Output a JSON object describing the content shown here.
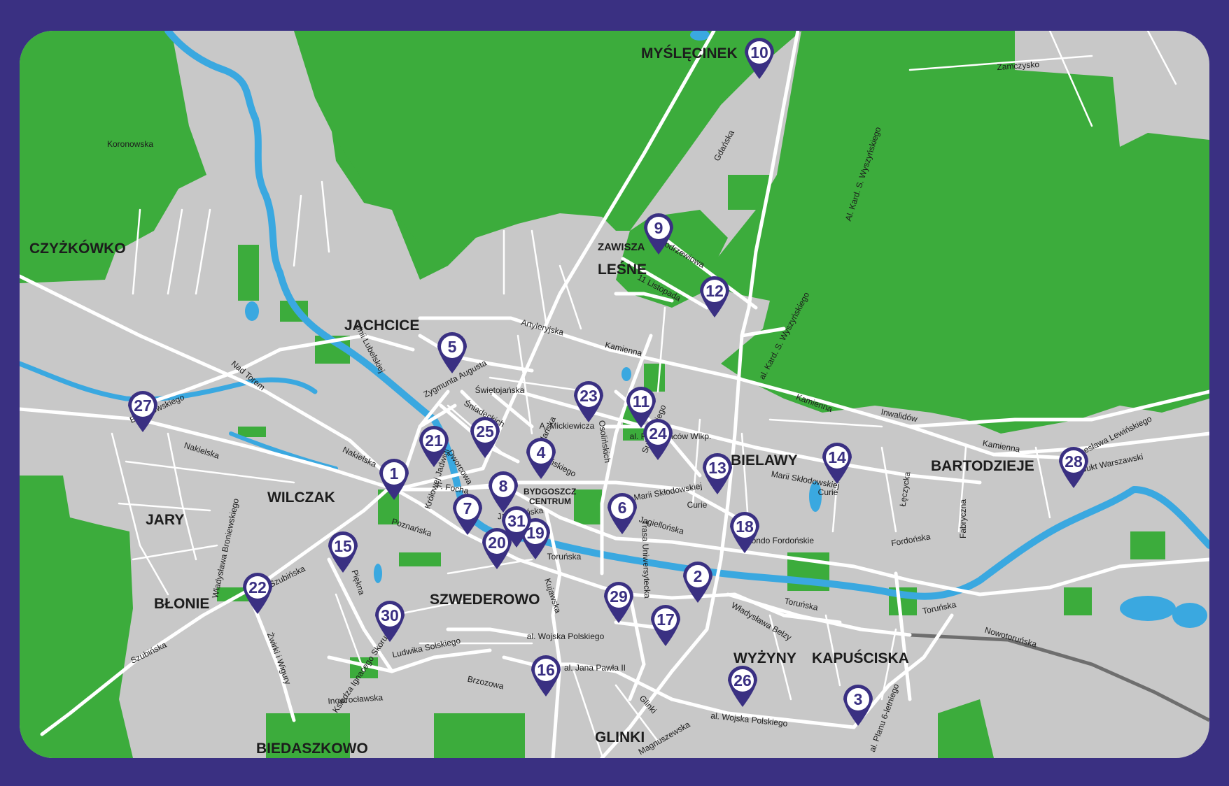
{
  "map": {
    "colors": {
      "frame": "#3a3082",
      "urban": "#c8c8c8",
      "forest": "#3cac3c",
      "water": "#3aa8e0",
      "road": "#ffffff",
      "railway": "#6e6e6e",
      "marker": "#3a3082"
    },
    "districts": [
      {
        "id": "czyzkowko",
        "label": "CZYŻKÓWKO"
      },
      {
        "id": "jachcice",
        "label": "JACHCICE"
      },
      {
        "id": "myslecinek",
        "label": "MYŚLĘCINEK"
      },
      {
        "id": "zawisza",
        "label": "ZAWISZA"
      },
      {
        "id": "lesne",
        "label": "LEŚNE"
      },
      {
        "id": "bielawy",
        "label": "BIELAWY"
      },
      {
        "id": "bartodzieje",
        "label": "BARTODZIEJE"
      },
      {
        "id": "wilczak",
        "label": "WILCZAK"
      },
      {
        "id": "jary",
        "label": "JARY"
      },
      {
        "id": "blonie",
        "label": "BŁONIE"
      },
      {
        "id": "szwederowo",
        "label": "SZWEDEROWO"
      },
      {
        "id": "wyzyny",
        "label": "WYŻYNY"
      },
      {
        "id": "kapusciska",
        "label": "KAPUŚCISKA"
      },
      {
        "id": "glinki",
        "label": "GLINKI"
      },
      {
        "id": "biedaszkowo",
        "label": "BIEDASZKOWO"
      },
      {
        "id": "centrum",
        "label": "BYDGOSZCZ"
      },
      {
        "id": "centrum2",
        "label": "CENTRUM"
      }
    ],
    "streets": [
      "Koronowska",
      "Zamczysko",
      "Gdańska",
      "Al. Kard. S. Wyszyńskiego",
      "Modrzewiowa",
      "11 Listopada",
      "Artyleryjska",
      "Kamienna",
      "Zygmunta Augusta",
      "Unii Lubelskiej",
      "Nad Torem",
      "Bronikowskiego",
      "Świętojańska",
      "Śniadeckich",
      "Gdańska",
      "A. Mickiewicza",
      "al. Powstańców Wlkp.",
      "Sułkowskiego",
      "Nakielska",
      "Nakielska",
      "Królowej Jadwigi",
      "Dworcowa",
      "F. Focha",
      "Krasińskiego",
      "Osolińskich",
      "Jagiellońska",
      "Jagiellońska",
      "Marii Skłodowskiej",
      "Curie",
      "Marii Skłodowskiej",
      "Curie",
      "Łęczycka",
      "Fabryczna",
      "Inwalidów",
      "Kamienna",
      "Kamienna",
      "Czesława Lewińskiego",
      "Wiadukt Warszawski",
      "Rondo Fordońskie",
      "Fordońska",
      "Poznańska",
      "Toruńska",
      "Trasa Uniwersytecka",
      "Szubińska",
      "Władysława Broniewskiego",
      "Piękna",
      "Kujawska",
      "Ludwika Solskiego",
      "al. Wojska Polskiego",
      "al. Jana Pawła II",
      "Brzozowa",
      "Inowrocławska",
      "Księdza Ignacego Skorupki",
      "Żwirki i Wigury",
      "Szubińska",
      "Glinki",
      "Magnuszewska",
      "al. Wojska Polskiego",
      "Toruńska",
      "Toruńska",
      "Władysława Bełzy",
      "Nowotoruńska",
      "al. Planu 6-letniego",
      "al. Kard. S. Wyszyńskiego"
    ],
    "markers": [
      {
        "number": "1"
      },
      {
        "number": "2"
      },
      {
        "number": "3"
      },
      {
        "number": "4"
      },
      {
        "number": "5"
      },
      {
        "number": "6"
      },
      {
        "number": "7"
      },
      {
        "number": "8"
      },
      {
        "number": "9"
      },
      {
        "number": "10"
      },
      {
        "number": "11"
      },
      {
        "number": "12"
      },
      {
        "number": "13"
      },
      {
        "number": "14"
      },
      {
        "number": "15"
      },
      {
        "number": "16"
      },
      {
        "number": "17"
      },
      {
        "number": "18"
      },
      {
        "number": "19"
      },
      {
        "number": "20"
      },
      {
        "number": "21"
      },
      {
        "number": "22"
      },
      {
        "number": "23"
      },
      {
        "number": "24"
      },
      {
        "number": "25"
      },
      {
        "number": "26"
      },
      {
        "number": "27"
      },
      {
        "number": "28"
      },
      {
        "number": "29"
      },
      {
        "number": "30"
      },
      {
        "number": "31"
      }
    ]
  }
}
